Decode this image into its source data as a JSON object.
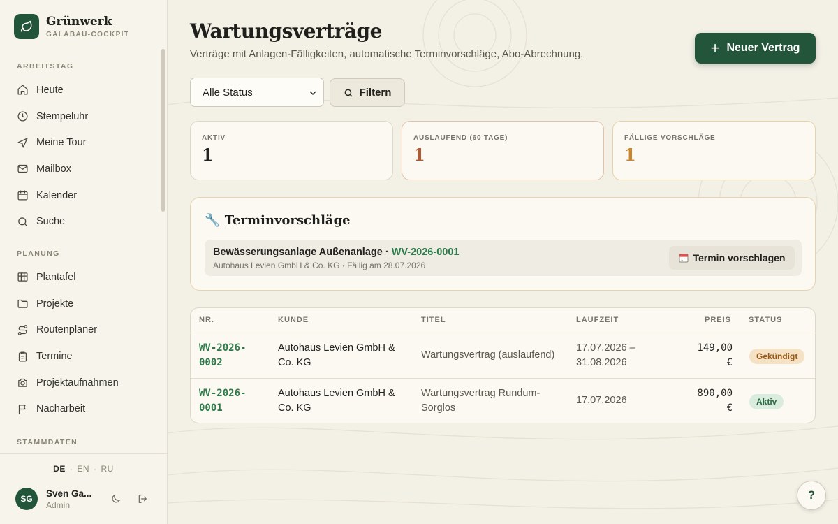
{
  "brand": {
    "name": "Grünwerk",
    "subtitle": "GALABAU-COCKPIT"
  },
  "sidebar": {
    "sections": [
      {
        "label": "ARBEITSTAG",
        "items": [
          {
            "label": "Heute",
            "icon": "home-icon"
          },
          {
            "label": "Stempeluhr",
            "icon": "clock-icon"
          },
          {
            "label": "Meine Tour",
            "icon": "navigation-icon"
          },
          {
            "label": "Mailbox",
            "icon": "mail-icon"
          },
          {
            "label": "Kalender",
            "icon": "calendar-icon"
          },
          {
            "label": "Suche",
            "icon": "search-icon"
          }
        ]
      },
      {
        "label": "PLANUNG",
        "items": [
          {
            "label": "Plantafel",
            "icon": "board-icon"
          },
          {
            "label": "Projekte",
            "icon": "folder-icon"
          },
          {
            "label": "Routenplaner",
            "icon": "route-icon"
          },
          {
            "label": "Termine",
            "icon": "clipboard-icon"
          },
          {
            "label": "Projektaufnahmen",
            "icon": "camera-icon"
          },
          {
            "label": "Nacharbeit",
            "icon": "flag-icon"
          }
        ]
      },
      {
        "label": "STAMMDATEN",
        "items": []
      }
    ],
    "languages": [
      "DE",
      "EN",
      "RU"
    ],
    "active_language": "DE",
    "user": {
      "initials": "SG",
      "name": "Sven Ga...",
      "role": "Admin"
    }
  },
  "header": {
    "title": "Wartungsverträge",
    "subtitle": "Verträge mit Anlagen-Fälligkeiten, automatische Terminvorschläge, Abo-Abrechnung.",
    "new_button": "Neuer Vertrag"
  },
  "filters": {
    "status_value": "Alle Status",
    "filter_button": "Filtern"
  },
  "stats": [
    {
      "label": "AKTIV",
      "value": "1",
      "color": "#232320"
    },
    {
      "label": "AUSLAUFEND (60 TAGE)",
      "value": "1",
      "color": "#b05a33"
    },
    {
      "label": "FÄLLIGE VORSCHLÄGE",
      "value": "1",
      "color": "#c9852b"
    }
  ],
  "proposals": {
    "title": "Terminvorschläge",
    "items": [
      {
        "title": "Bewässerungsanlage Außenanlage · ",
        "code": "WV-2026-0001",
        "subtitle": "Autohaus Levien GmbH & Co. KG · Fällig am 28.07.2026",
        "button": "Termin vorschlagen"
      }
    ]
  },
  "table": {
    "columns": [
      "NR.",
      "KUNDE",
      "TITEL",
      "LAUFZEIT",
      "PREIS",
      "STATUS"
    ],
    "rows": [
      {
        "nr_a": "WV-2026-",
        "nr_b": "0002",
        "kunde_a": "Autohaus Levien GmbH &",
        "kunde_b": "Co. KG",
        "titel_a": "Wartungsvertrag (auslaufend)",
        "titel_b": "",
        "laufzeit_a": "17.07.2026 –",
        "laufzeit_b": "31.08.2026",
        "preis_a": "149,00",
        "preis_b": "€",
        "status": "Gekündigt",
        "status_type": "cancel"
      },
      {
        "nr_a": "WV-2026-",
        "nr_b": "0001",
        "kunde_a": "Autohaus Levien GmbH &",
        "kunde_b": "Co. KG",
        "titel_a": "Wartungsvertrag Rundum-",
        "titel_b": "Sorglos",
        "laufzeit_a": "17.07.2026",
        "laufzeit_b": "",
        "preis_a": "890,00",
        "preis_b": "€",
        "status": "Aktiv",
        "status_type": "active"
      }
    ]
  },
  "help_label": "?",
  "colors": {
    "brand": "#22553a",
    "link": "#2e7a4a",
    "warn": "#b05a33",
    "amber": "#c9852b"
  }
}
